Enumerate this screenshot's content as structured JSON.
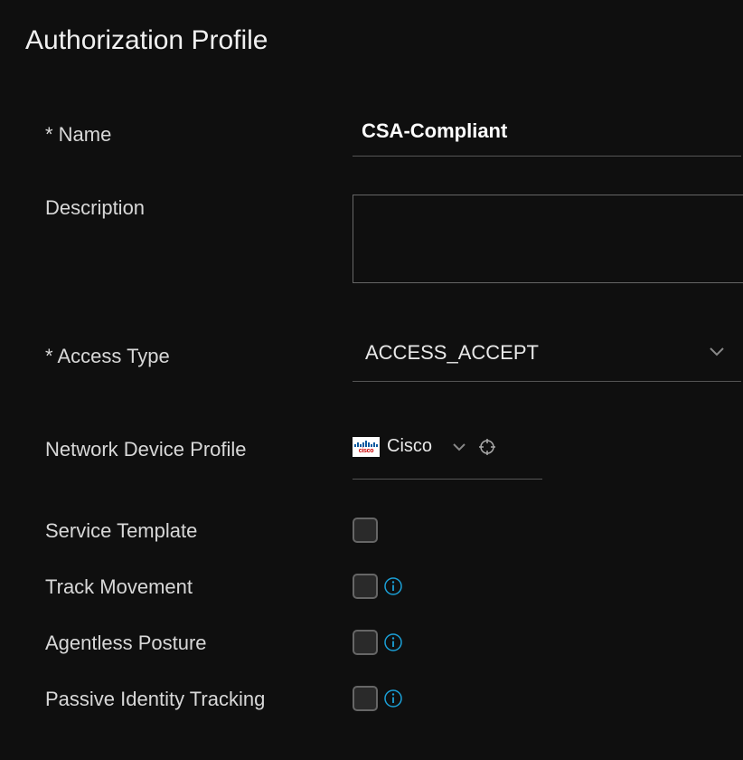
{
  "title": "Authorization Profile",
  "fields": {
    "name": {
      "label": "* Name",
      "value": "CSA-Compliant"
    },
    "description": {
      "label": "Description",
      "value": ""
    },
    "access_type": {
      "label": "* Access Type",
      "value": "ACCESS_ACCEPT"
    },
    "network_device_profile": {
      "label": "Network Device Profile",
      "value": "Cisco"
    },
    "service_template": {
      "label": "Service Template",
      "checked": false
    },
    "track_movement": {
      "label": "Track Movement",
      "checked": false
    },
    "agentless_posture": {
      "label": "Agentless Posture",
      "checked": false
    },
    "passive_identity_tracking": {
      "label": "Passive Identity Tracking",
      "checked": false
    }
  }
}
